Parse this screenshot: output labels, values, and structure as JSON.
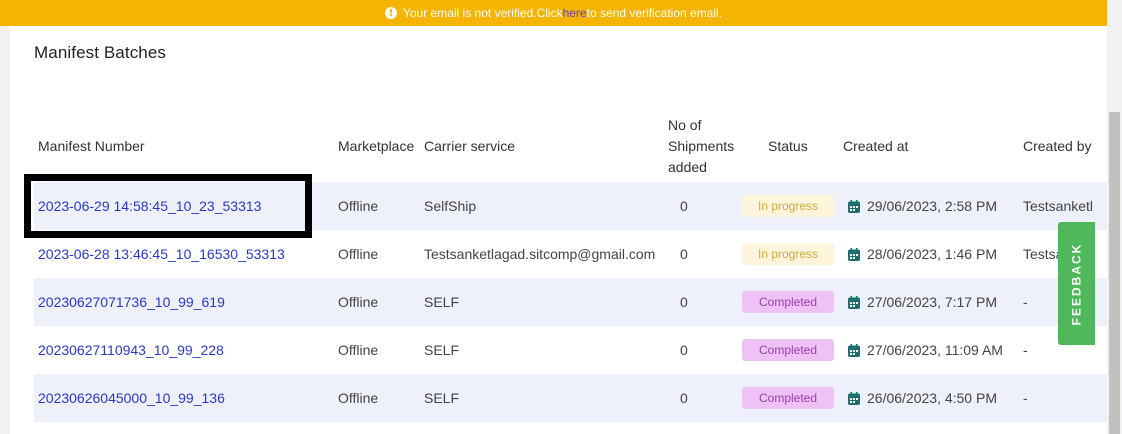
{
  "banner": {
    "text_before": "Your email is not verified.Click ",
    "link": "here",
    "text_after": " to send verification email.",
    "color": "#f4b400"
  },
  "page": {
    "title": "Manifest Batches"
  },
  "table": {
    "headers": {
      "manifest_number": "Manifest Number",
      "marketplace": "Marketplace",
      "carrier_service": "Carrier service",
      "shipments_line1": "No of",
      "shipments_line2": "Shipments",
      "shipments_line3": "added",
      "status": "Status",
      "created_at": "Created at",
      "created_by": "Created by"
    },
    "rows": [
      {
        "manifest": "2023-06-29 14:58:45_10_23_53313",
        "marketplace": "Offline",
        "carrier": "SelfShip",
        "shipments": "0",
        "status": "In progress",
        "created_at": "29/06/2023, 2:58 PM",
        "created_by": "Testsanketl"
      },
      {
        "manifest": "2023-06-28 13:46:45_10_16530_53313",
        "marketplace": "Offline",
        "carrier": "Testsanketlagad.sitcomp@gmail.com",
        "shipments": "0",
        "status": "In progress",
        "created_at": "28/06/2023, 1:46 PM",
        "created_by": "Testsa"
      },
      {
        "manifest": "20230627071736_10_99_619",
        "marketplace": "Offline",
        "carrier": "SELF",
        "shipments": "0",
        "status": "Completed",
        "created_at": "27/06/2023, 7:17 PM",
        "created_by": "-"
      },
      {
        "manifest": "20230627110943_10_99_228",
        "marketplace": "Offline",
        "carrier": "SELF",
        "shipments": "0",
        "status": "Completed",
        "created_at": "27/06/2023, 11:09 AM",
        "created_by": "-"
      },
      {
        "manifest": "20230626045000_10_99_136",
        "marketplace": "Offline",
        "carrier": "SELF",
        "shipments": "0",
        "status": "Completed",
        "created_at": "26/06/2023, 4:50 PM",
        "created_by": "-"
      }
    ]
  },
  "feedback": {
    "label": "FEEDBACK",
    "color": "#4fb85a"
  },
  "icons": {
    "banner": "info-icon",
    "date": "calendar-icon"
  }
}
